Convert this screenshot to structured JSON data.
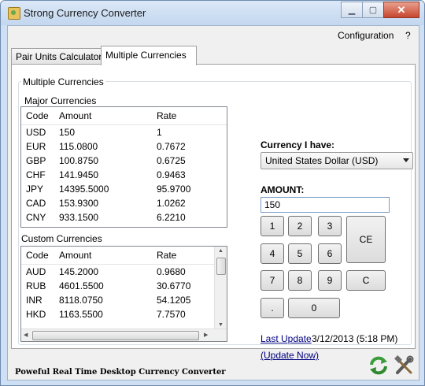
{
  "window": {
    "title": "Strong Currency Converter",
    "minimize_icon": "minimize-icon",
    "maximize_icon": "maximize-icon",
    "close_icon": "close-icon"
  },
  "menu": {
    "configuration": "Configuration",
    "help": "?"
  },
  "tabs": [
    {
      "label": "Pair Units Calculator",
      "active": false
    },
    {
      "label": "Multiple Currencies",
      "active": true
    }
  ],
  "group_title": "Multiple Currencies",
  "major": {
    "label": "Major Currencies",
    "columns": [
      "Code",
      "Amount",
      "Rate"
    ],
    "rows": [
      [
        "USD",
        "150",
        "1"
      ],
      [
        "EUR",
        "115.0800",
        "0.7672"
      ],
      [
        "GBP",
        "100.8750",
        "0.6725"
      ],
      [
        "CHF",
        "141.9450",
        "0.9463"
      ],
      [
        "JPY",
        "14395.5000",
        "95.9700"
      ],
      [
        "CAD",
        "153.9300",
        "1.0262"
      ],
      [
        "CNY",
        "933.1500",
        "6.2210"
      ]
    ]
  },
  "custom": {
    "label": "Custom Currencies",
    "columns": [
      "Code",
      "Amount",
      "Rate"
    ],
    "rows": [
      [
        "AUD",
        "145.2000",
        "0.9680"
      ],
      [
        "RUB",
        "4601.5500",
        "30.6770"
      ],
      [
        "INR",
        "8118.0750",
        "54.1205"
      ],
      [
        "HKD",
        "1163.5500",
        "7.7570"
      ]
    ]
  },
  "currency_have": {
    "label": "Currency I have:",
    "selected": "United States Dollar (USD)"
  },
  "amount": {
    "label": "AMOUNT:",
    "value": "150"
  },
  "keypad": {
    "k1": "1",
    "k2": "2",
    "k3": "3",
    "ce": "CE",
    "k4": "4",
    "k5": "5",
    "k6": "6",
    "k7": "7",
    "k8": "8",
    "k9": "9",
    "c": "C",
    "dot": ".",
    "k0": "0"
  },
  "update": {
    "last_update_link": "Last Update",
    "timestamp": "3/12/2013 (5:18 PM)",
    "update_now_link": "(Update Now)"
  },
  "footer": "Poweful Real Time Desktop Currency Converter",
  "icons": {
    "refresh": "refresh-icon",
    "tools": "tools-icon"
  },
  "colors": {
    "link": "#000080",
    "title_bar": "#cfe0f4",
    "close_button": "#c7462e"
  }
}
